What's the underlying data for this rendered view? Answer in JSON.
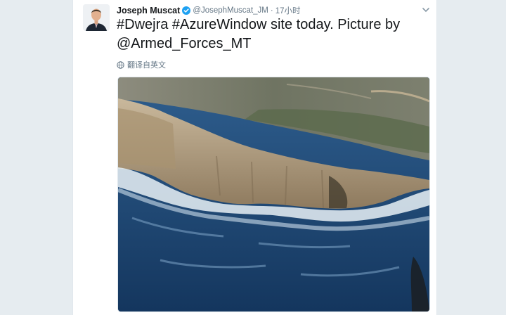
{
  "tweet": {
    "author_name": "Joseph Muscat",
    "handle": "@JosephMuscat_JM",
    "separator": "·",
    "time": "17小时",
    "text": "#Dwejra #AzureWindow site today. Picture by @Armed_Forces_MT",
    "translate_label": "翻译自英文"
  },
  "icons": {
    "verified": "verified-badge-icon",
    "caret": "chevron-down-icon",
    "translate": "globe-icon"
  },
  "colors": {
    "verified": "#1da1f2",
    "text": "#14171a",
    "muted": "#657786",
    "background": "#e6ecf0"
  }
}
